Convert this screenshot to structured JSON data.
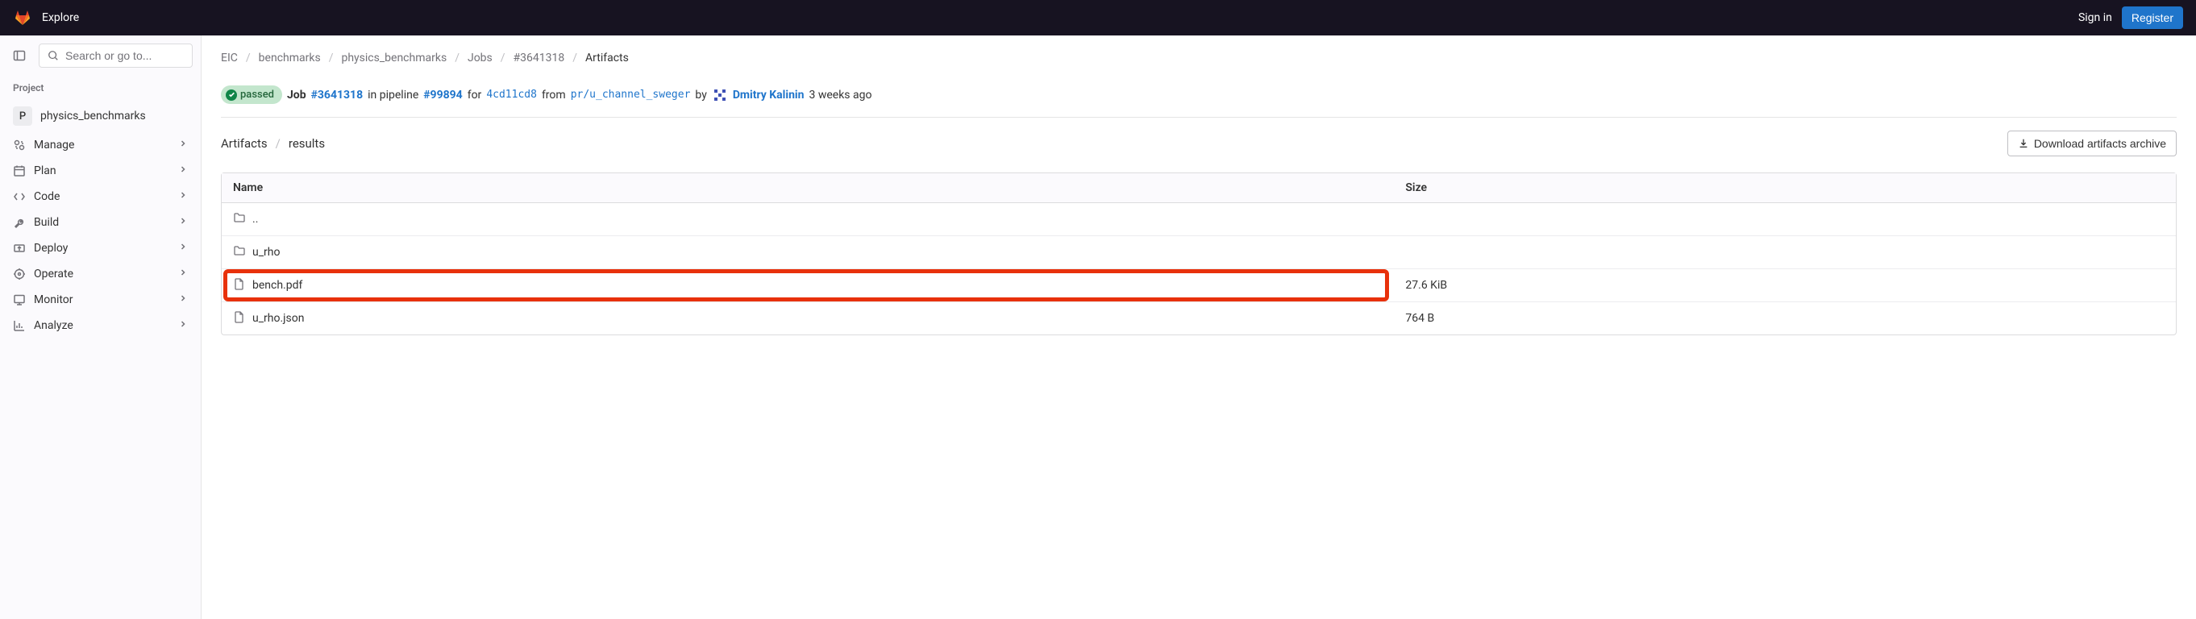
{
  "top_nav": {
    "explore": "Explore",
    "signin": "Sign in",
    "register": "Register"
  },
  "sidebar": {
    "search_placeholder": "Search or go to...",
    "section_label": "Project",
    "project_avatar": "P",
    "project_name": "physics_benchmarks",
    "items": [
      {
        "label": "Manage"
      },
      {
        "label": "Plan"
      },
      {
        "label": "Code"
      },
      {
        "label": "Build"
      },
      {
        "label": "Deploy"
      },
      {
        "label": "Operate"
      },
      {
        "label": "Monitor"
      },
      {
        "label": "Analyze"
      }
    ]
  },
  "breadcrumbs": {
    "items": [
      "EIC",
      "benchmarks",
      "physics_benchmarks",
      "Jobs",
      "#3641318",
      "Artifacts"
    ]
  },
  "job_info": {
    "status": "passed",
    "job_label": "Job",
    "job_id": "#3641318",
    "in_pipeline": "in pipeline",
    "pipeline_id": "#99894",
    "for_label": "for",
    "commit": "4cd11cd8",
    "from_label": "from",
    "branch": "pr/u_channel_sweger",
    "by_label": "by",
    "user_name": "Dmitry Kalinin",
    "time_ago": "3 weeks ago"
  },
  "artifact_path": {
    "items": [
      "Artifacts",
      "results"
    ]
  },
  "download_button": "Download artifacts archive",
  "table": {
    "header_name": "Name",
    "header_size": "Size",
    "rows": [
      {
        "name": "..",
        "type": "folder",
        "size": "",
        "highlighted": false
      },
      {
        "name": "u_rho",
        "type": "folder",
        "size": "",
        "highlighted": false
      },
      {
        "name": "bench.pdf",
        "type": "file",
        "size": "27.6 KiB",
        "highlighted": true
      },
      {
        "name": "u_rho.json",
        "type": "file",
        "size": "764 B",
        "highlighted": false
      }
    ]
  }
}
